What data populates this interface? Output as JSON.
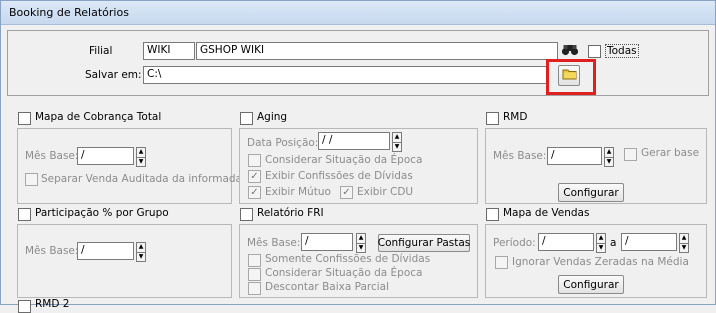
{
  "window": {
    "title": "Booking de Relatórios"
  },
  "header": {
    "filial_label": "Filial",
    "filial_code": "WIKI",
    "filial_name": "GSHOP WIKI",
    "todas_label": "Todas",
    "salvar_label": "Salvar em:",
    "salvar_path": "C:\\",
    "search_icon": "binoculars-icon",
    "folder_icon": "folder-icon"
  },
  "sections": {
    "mapa_cobranca": {
      "title": "Mapa de Cobrança Total",
      "mes_base_label": "Mês Base:",
      "mes_base_value": "/",
      "separar_label": "Separar Venda Auditada da informada"
    },
    "aging": {
      "title": "Aging",
      "data_posicao_label": "Data Posição:",
      "data_posicao_value": " /  /",
      "considerar_label": "Considerar Situação da Época",
      "exibir_confissoes_label": "Exibir Confissões de Dívidas",
      "exibir_mutuo_label": "Exibir Mútuo",
      "exibir_cdu_label": "Exibir CDU"
    },
    "rmd": {
      "title": "RMD",
      "mes_base_label": "Mês Base:",
      "mes_base_value": "/",
      "gerar_base_label": "Gerar base",
      "configurar_label": "Configurar"
    },
    "participacao": {
      "title": "Participação % por Grupo",
      "mes_base_label": "Mês Base:",
      "mes_base_value": "/"
    },
    "relatorio_fri": {
      "title": "Relatório FRI",
      "mes_base_label": "Mês Base:",
      "mes_base_value": "/",
      "configurar_pastas_label": "Configurar Pastas",
      "somente_label": "Somente Confissões de Dívidas",
      "considerar_label": "Considerar Situação da Época",
      "descontar_label": "Descontar Baixa Parcial"
    },
    "mapa_vendas": {
      "title": "Mapa de Vendas",
      "periodo_label": "Período:",
      "periodo_from": "/",
      "a_label": "a",
      "periodo_to": "/",
      "ignorar_label": "Ignorar Vendas Zeradas na Média",
      "configurar_label": "Configurar"
    },
    "rmd2": {
      "title": "RMD 2"
    }
  },
  "glyphs": {
    "check": "✓",
    "up": "▲",
    "down": "▼"
  }
}
